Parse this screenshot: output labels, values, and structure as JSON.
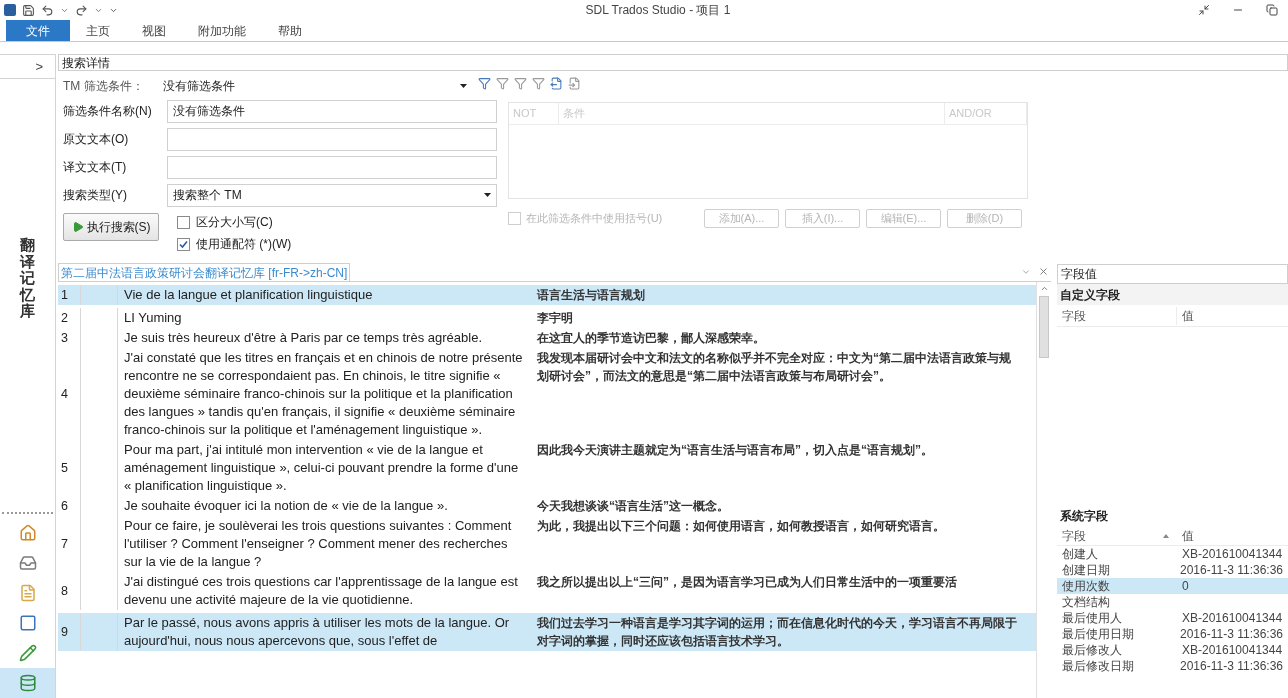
{
  "window": {
    "title": "SDL Trados Studio - 项目 1"
  },
  "menu": [
    {
      "label": "文件",
      "selected": true
    },
    {
      "label": "主页",
      "selected": false
    },
    {
      "label": "视图",
      "selected": false
    },
    {
      "label": "附加功能",
      "selected": false
    },
    {
      "label": "帮助",
      "selected": false
    }
  ],
  "sidebar": {
    "expand": ">",
    "label": "翻译记忆库",
    "nav": [
      {
        "kind": "home",
        "selected": false
      },
      {
        "kind": "tray",
        "selected": false
      },
      {
        "kind": "file",
        "selected": false
      },
      {
        "kind": "square",
        "selected": false
      },
      {
        "kind": "pencil",
        "selected": false
      },
      {
        "kind": "database",
        "selected": true
      }
    ]
  },
  "search": {
    "header": "搜索详情",
    "filter_label": "TM 筛选条件：",
    "filter_value": "没有筛选条件",
    "fields": [
      {
        "label": "筛选条件名称(N)",
        "value": "没有筛选条件",
        "kind": "text"
      },
      {
        "label": "原文文本(O)",
        "kind": "text"
      },
      {
        "label": "译文文本(T)",
        "kind": "text"
      },
      {
        "label": "搜索类型(Y)",
        "value": "搜索整个 TM",
        "kind": "select"
      }
    ],
    "run_button": "执行搜索(S)",
    "options": [
      {
        "label": "区分大小写(C)",
        "checked": false
      },
      {
        "label": "使用通配符 (*)(W)",
        "checked": true
      }
    ],
    "conditions": {
      "columns": [
        "NOT",
        "条件",
        "AND/OR"
      ],
      "brackets": {
        "label": "在此筛选条件中使用括号(U)",
        "checked": false,
        "disabled": true
      },
      "buttons": [
        {
          "label": "添加(A)...",
          "disabled": true
        },
        {
          "label": "插入(I)...",
          "disabled": true
        },
        {
          "label": "编辑(E)...",
          "disabled": true
        },
        {
          "label": "删除(D)",
          "disabled": true
        }
      ]
    }
  },
  "grid": {
    "tab": "第二届中法语言政策研讨会翻译记忆库 [fr-FR->zh-CN]",
    "rows": [
      {
        "number": "1",
        "source": "Vie de la langue et planification linguistique",
        "target": "语言生活与语言规划",
        "selected": true
      },
      {
        "number": "2",
        "source": "LI Yuming",
        "target": "李宇明",
        "selected": false
      },
      {
        "number": "3",
        "source": "Je suis très heureux d'être à Paris par ce temps très agréable.",
        "target": "在这宜人的季节造访巴黎，鄙人深感荣幸。",
        "selected": false
      },
      {
        "number": "4",
        "source": "J'ai constaté que les titres en français et en chinois de notre présente rencontre ne se correspondaient pas. En chinois, le titre signifie « deuxième séminaire franco-chinois sur la politique et la planification des langues » tandis qu'en français, il signifie « deuxième séminaire franco-chinois sur la politique et l'aménagement linguistique ».",
        "target": "我发现本届研讨会中文和法文的名称似乎并不完全对应：中文为“第二届中法语言政策与规划研讨会”，而法文的意思是“第二届中法语言政策与布局研讨会”。",
        "selected": false
      },
      {
        "number": "5",
        "source": "Pour ma part, j'ai intitulé mon intervention « vie de la langue et aménagement linguistique », celui-ci pouvant prendre la forme d'une « planification linguistique ».",
        "target": "因此我今天演讲主题就定为“语言生活与语言布局”，切入点是“语言规划”。",
        "selected": false
      },
      {
        "number": "6",
        "source": "Je souhaite évoquer ici la notion de « vie de la langue ».",
        "target": "今天我想谈谈“语言生活”这一概念。",
        "selected": false
      },
      {
        "number": "7",
        "source": "Pour ce faire, je soulèverai les trois questions suivantes : Comment l'utiliser ? Comment l'enseigner ? Comment mener des recherches sur la vie de la langue ?",
        "target": "为此，我提出以下三个问题：如何使用语言，如何教授语言，如何研究语言。",
        "selected": false
      },
      {
        "number": "8",
        "source": "J'ai distingué ces trois questions car l'apprentissage de la langue est devenu une activité majeure de la vie quotidienne.",
        "target": "我之所以提出以上“三问”，是因为语言学习已成为人们日常生活中的一项重要活",
        "selected": false
      },
      {
        "number": "9",
        "source": "Par le passé, nous avons appris à utiliser les mots de la langue. Or aujourd'hui, nous nous apercevons que, sous l'effet de",
        "target": "我们过去学习一种语言是学习其字词的运用；而在信息化时代的今天，学习语言不再局限于对字词的掌握，同时还应该包括语言技术学习。",
        "selected": true
      }
    ]
  },
  "fields_panel": {
    "title": "字段值",
    "custom": {
      "heading": "自定义字段",
      "columns": [
        "字段",
        "值"
      ]
    },
    "system": {
      "heading": "系统字段",
      "columns": [
        "字段",
        "值"
      ],
      "rows": [
        {
          "field": "创建人",
          "value": "XB-201610041344",
          "selected": false
        },
        {
          "field": "创建日期",
          "value": "2016-11-3 11:36:36",
          "selected": false
        },
        {
          "field": "使用次数",
          "value": "0",
          "selected": true
        },
        {
          "field": "文档结构",
          "value": "",
          "selected": false
        },
        {
          "field": "最后使用人",
          "value": "XB-201610041344",
          "selected": false
        },
        {
          "field": "最后使用日期",
          "value": "2016-11-3 11:36:36",
          "selected": false
        },
        {
          "field": "最后修改人",
          "value": "XB-201610041344",
          "selected": false
        },
        {
          "field": "最后修改日期",
          "value": "2016-11-3 11:36:36",
          "selected": false
        }
      ]
    }
  }
}
